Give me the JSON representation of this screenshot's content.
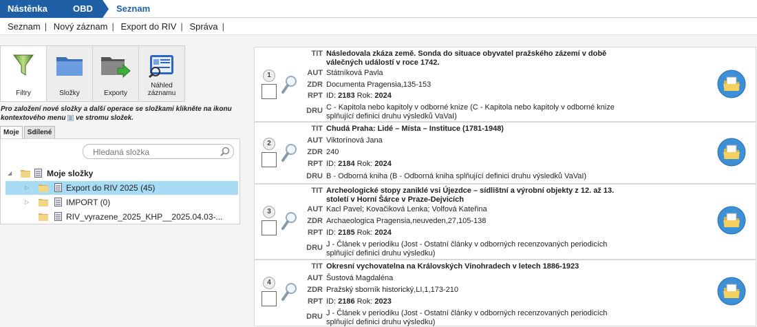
{
  "breadcrumb": [
    "Nástěnka",
    "OBD",
    "Seznam"
  ],
  "menu": [
    "Seznam",
    "Nový záznam",
    "Export do RIV",
    "Správa"
  ],
  "toolbar": {
    "filters": "Filtry",
    "folders": "Složky",
    "exports": "Exporty",
    "preview_line1": "Náhled",
    "preview_line2": "záznamu"
  },
  "hint_part1": "Pro založení nové složky a další operace se složkami klikněte na ikonu kontextového menu",
  "hint_part2": "ve stromu složek.",
  "tabs": [
    "Moje",
    "Sdílené"
  ],
  "search_placeholder": "Hledaná složka",
  "tree": {
    "root": "Moje složky",
    "items": [
      "Export do RIV 2025 (45)",
      "IMPORT (0)",
      "RIV_vyrazene_2025_KHP__2025.04.03-..."
    ]
  },
  "labels": {
    "tit": "TIT",
    "aut": "AUT",
    "zdr": "ZDR",
    "rpt": "RPT",
    "dru": "DRU",
    "id_prefix": "ID:",
    "year_prefix": "Rok:"
  },
  "records": [
    {
      "num": "1",
      "title": "Následovala zkáza země. Sonda do situace obyvatel pražského zázemí v době válečných událostí v roce 1742.",
      "author": "Státníková Pavla",
      "source": "Documenta Pragensia,135-153",
      "id": "2183",
      "year": "2024",
      "type": "C - Kapitola nebo kapitoly v odborné knize  (C - Kapitola nebo kapitoly v odborné knize splňující definici druhu výsledků VaVaI)"
    },
    {
      "num": "2",
      "title": "Chudá Praha: Lidé – Místa – Instituce (1781-1948)",
      "author": "Viktorínová Jana",
      "source": "240",
      "id": "2184",
      "year": "2024",
      "type": "B - Odborná kniha  (B - Odborná kniha splňující definici druhu výsledků VaVaI)"
    },
    {
      "num": "3",
      "title": "Archeologické stopy zaniklé vsi Újezdce – sídlištní a výrobní objekty z 12. až 13. století v Horní Šárce v Praze-Dejvicích",
      "author": "Kacl Pavel; Kovačiková Lenka; Volfová Kateřina",
      "source": "Archaeologica Pragensia,neuveden,27,105-138",
      "id": "2185",
      "year": "2024",
      "type": "J - Článek v periodiku  (Jost - Ostatní články v odborných recenzovaných periodicích splňující definici druhu výsledku)"
    },
    {
      "num": "4",
      "title": "Okresní vychovatelna na Královských Vinohradech v letech 1886-1923",
      "author": "Šustová Magdaléna",
      "source": "Pražský sborník historický,LI,1,173-210",
      "id": "2186",
      "year": "2023",
      "type": "J - Článek v periodiku  (Jost - Ostatní články v odborných recenzovaných periodicích splňující definici druhu výsledku)"
    }
  ]
}
